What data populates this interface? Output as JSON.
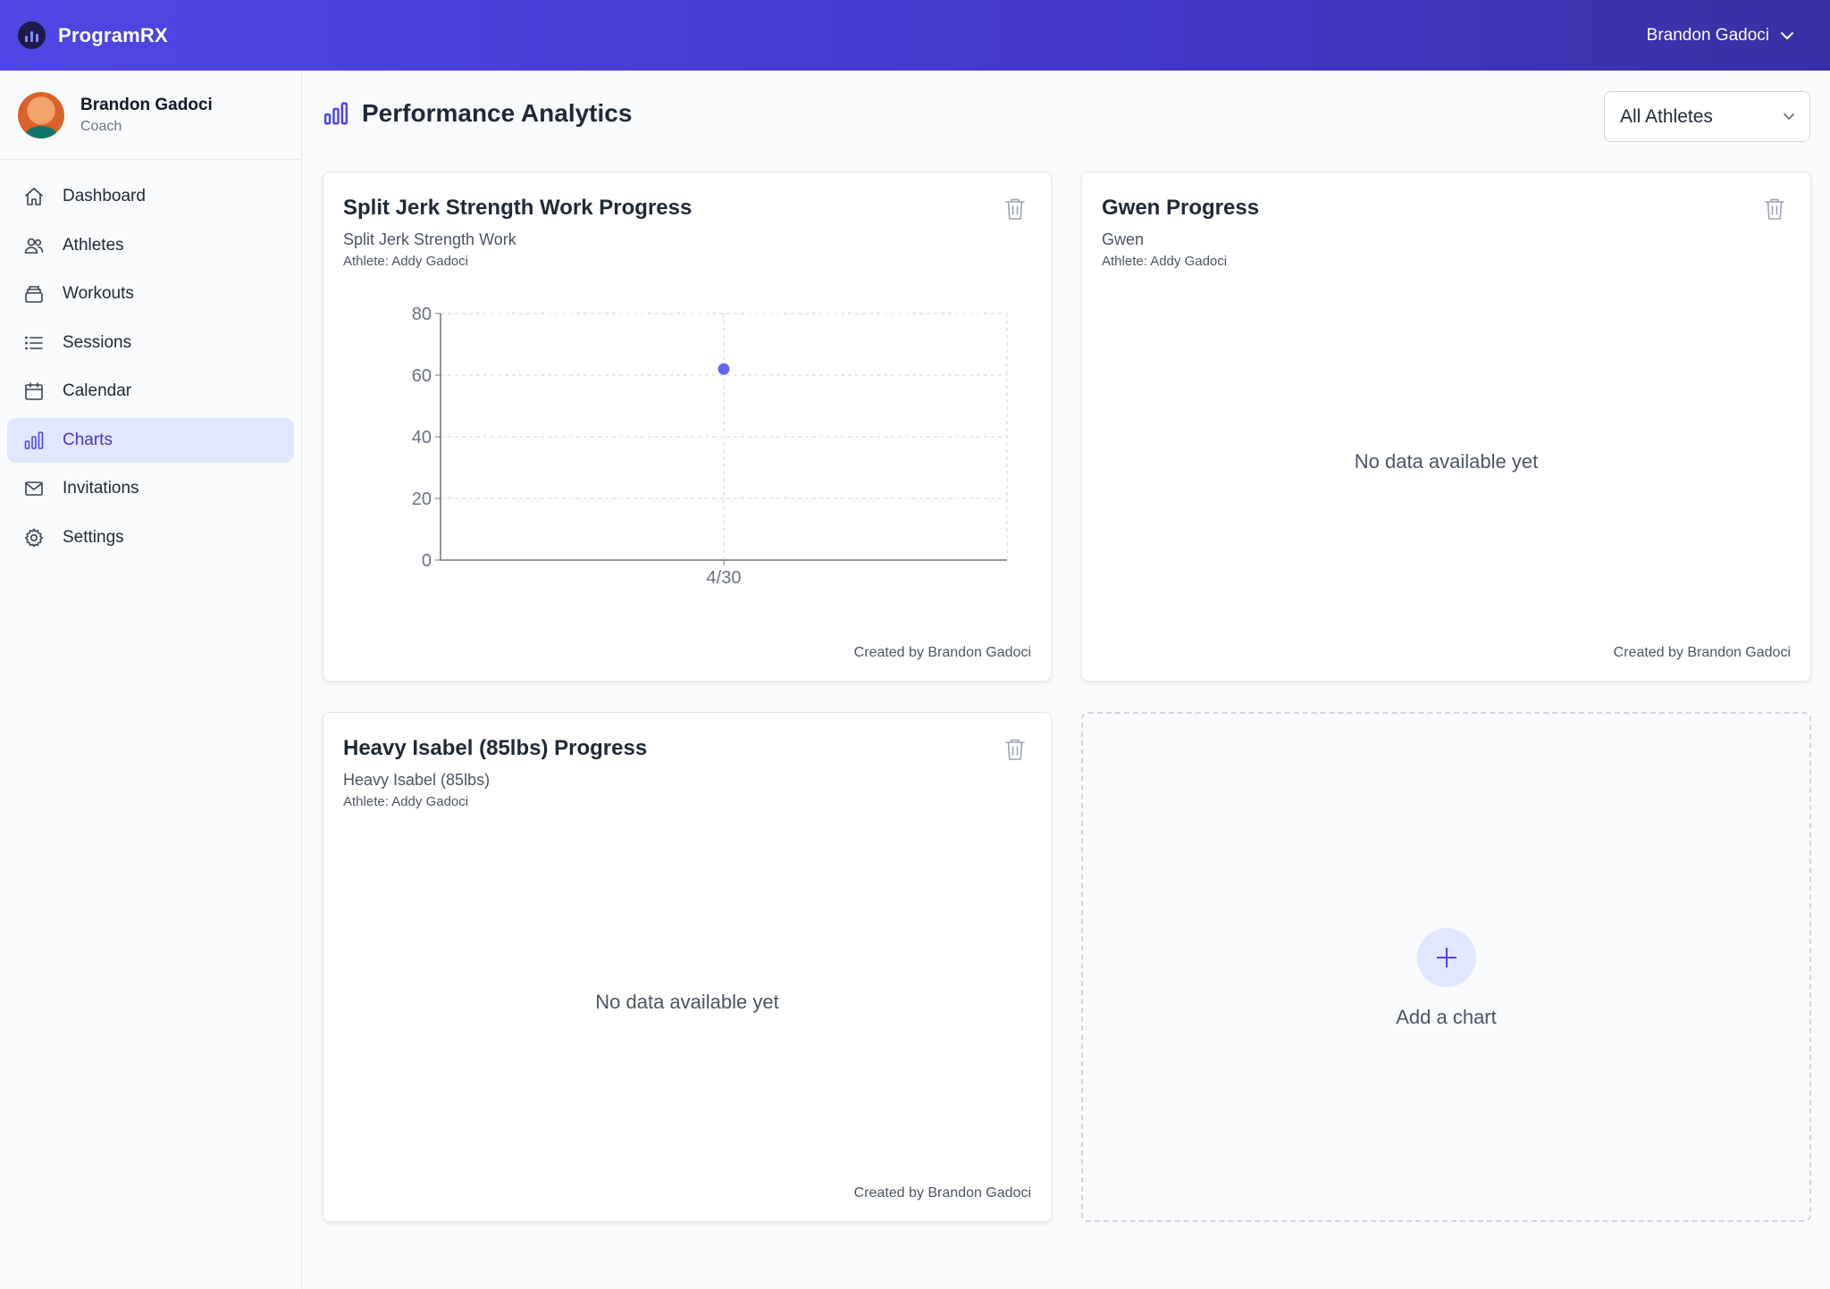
{
  "app": {
    "name": "ProgramRX",
    "user_menu_label": "Brandon Gadoci"
  },
  "profile": {
    "name": "Brandon Gadoci",
    "role": "Coach"
  },
  "nav": [
    {
      "label": "Dashboard",
      "icon": "home-icon",
      "active": false
    },
    {
      "label": "Athletes",
      "icon": "users-icon",
      "active": false
    },
    {
      "label": "Workouts",
      "icon": "box-icon",
      "active": false
    },
    {
      "label": "Sessions",
      "icon": "list-icon",
      "active": false
    },
    {
      "label": "Calendar",
      "icon": "calendar-icon",
      "active": false
    },
    {
      "label": "Charts",
      "icon": "bar-chart-icon",
      "active": true
    },
    {
      "label": "Invitations",
      "icon": "mail-icon",
      "active": false
    },
    {
      "label": "Settings",
      "icon": "gear-icon",
      "active": false
    }
  ],
  "page": {
    "title": "Performance Analytics",
    "filter_value": "All Athletes"
  },
  "cards": [
    {
      "title": "Split Jerk Strength Work Progress",
      "subtitle": "Split Jerk Strength Work",
      "athlete": "Athlete: Addy Gadoci",
      "footer": "Created by Brandon Gadoci"
    },
    {
      "title": "Gwen Progress",
      "subtitle": "Gwen",
      "athlete": "Athlete: Addy Gadoci",
      "empty": "No data available yet",
      "footer": "Created by Brandon Gadoci"
    },
    {
      "title": "Heavy Isabel (85lbs) Progress",
      "subtitle": "Heavy Isabel (85lbs)",
      "athlete": "Athlete: Addy Gadoci",
      "empty": "No data available yet",
      "footer": "Created by Brandon Gadoci"
    }
  ],
  "add_chart": {
    "label": "Add a chart"
  },
  "colors": {
    "accent": "#4f46e5",
    "point": "#6366f1",
    "header_start": "#4f46e5",
    "header_end": "#3730a3"
  },
  "chart_data": {
    "type": "scatter",
    "title": "",
    "x": [
      "4/30"
    ],
    "series": [
      {
        "values": [
          62
        ]
      }
    ],
    "y_ticks": [
      0,
      20,
      40,
      60,
      80
    ],
    "ylim": [
      0,
      80
    ],
    "grid": true
  }
}
